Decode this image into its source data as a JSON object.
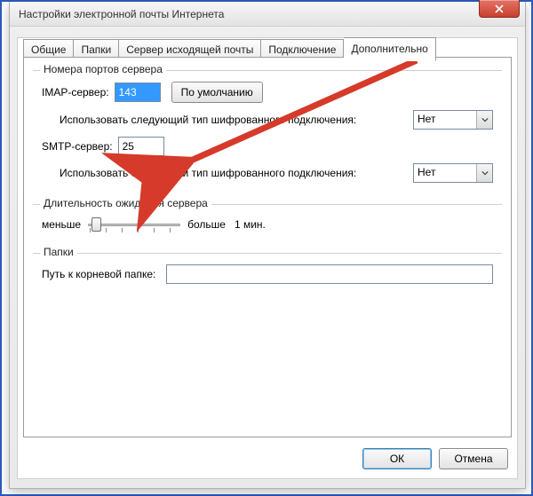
{
  "window": {
    "title": "Настройки электронной почты Интернета",
    "close_icon": "close-x"
  },
  "tabs": [
    {
      "label": "Общие"
    },
    {
      "label": "Папки"
    },
    {
      "label": "Сервер исходящей почты"
    },
    {
      "label": "Подключение"
    },
    {
      "label": "Дополнительно"
    }
  ],
  "ports_group": {
    "legend": "Номера портов сервера",
    "imap_label": "IMAP-сервер:",
    "imap_value": "143",
    "default_button": "По умолчанию",
    "enc_label": "Использовать следующий тип шифрованного подключения:",
    "imap_enc_value": "Нет",
    "smtp_label": "SMTP-сервер:",
    "smtp_value": "25",
    "smtp_enc_value": "Нет"
  },
  "timeout_group": {
    "legend": "Длительность ожидания сервера",
    "less": "меньше",
    "more": "больше",
    "value": "1 мин."
  },
  "folders_group": {
    "legend": "Папки",
    "root_label": "Путь к корневой папке:",
    "root_value": ""
  },
  "footer": {
    "ok": "ОК",
    "cancel": "Отмена"
  },
  "colors": {
    "annotation_red": "#d63a2a"
  }
}
